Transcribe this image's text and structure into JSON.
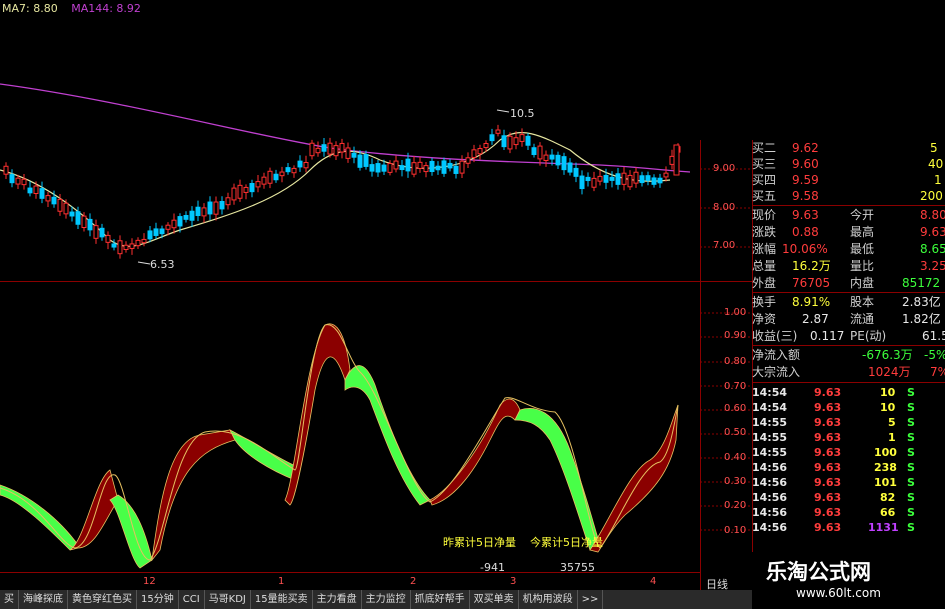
{
  "topbar": {
    "ma7_label": "MA7: 8.80",
    "ma144_label": "MA144: 8.92"
  },
  "colors": {
    "ma7": "#e6e6a0",
    "ma144": "#c040d0",
    "up": "#00c8ff",
    "down": "#ff3030",
    "grid": "#8b0000",
    "green_band": "#48ff48",
    "red_band": "#8b0000"
  },
  "price_axis": [
    "9.00",
    "8.00",
    "7.00"
  ],
  "indicator_axis": [
    "1.00",
    "0.90",
    "0.80",
    "0.70",
    "0.60",
    "0.50",
    "0.40",
    "0.30",
    "0.20",
    "0.10"
  ],
  "annotations": {
    "high": "10.5",
    "low": "6.53",
    "legend_prev": "昨累计5日净量",
    "legend_today": "今累计5日净量",
    "value_prev": "-941",
    "value_today": "35755"
  },
  "x_axis": [
    "12",
    "1",
    "2",
    "3",
    "4"
  ],
  "quote": {
    "bids": [
      {
        "label": "买二",
        "price": "9.62",
        "vol": "5"
      },
      {
        "label": "买三",
        "price": "9.60",
        "vol": "40"
      },
      {
        "label": "买四",
        "price": "9.59",
        "vol": "1"
      },
      {
        "label": "买五",
        "price": "9.58",
        "vol": "200"
      }
    ],
    "rows": [
      {
        "l1": "现价",
        "v1": "9.63",
        "l2": "今开",
        "v2": "8.80"
      },
      {
        "l1": "涨跌",
        "v1": "0.88",
        "l2": "最高",
        "v2": "9.63"
      },
      {
        "l1": "涨幅",
        "v1": "10.06%",
        "l2": "最低",
        "v2": "8.65"
      },
      {
        "l1": "总量",
        "v1": "16.2万",
        "l2": "量比",
        "v2": "3.25"
      },
      {
        "l1": "外盘",
        "v1": "76705",
        "l2": "内盘",
        "v2": "85172"
      },
      {
        "l1": "换手",
        "v1": "8.91%",
        "l2": "股本",
        "v2": "2.83亿"
      },
      {
        "l1": "净资",
        "v1": "2.87",
        "l2": "流通",
        "v2": "1.82亿"
      },
      {
        "l1": "收益(三)",
        "v1": "0.117",
        "l2": "PE(动)",
        "v2": "61.5"
      }
    ],
    "netflow": {
      "label": "净流入额",
      "value": "-676.3万",
      "pct": "-5%"
    },
    "block": {
      "label": "大宗流入",
      "value": "1024万",
      "pct": "7%"
    }
  },
  "ticks": [
    {
      "t": "14:54",
      "p": "9.63",
      "v": "10",
      "s": "S"
    },
    {
      "t": "14:54",
      "p": "9.63",
      "v": "10",
      "s": "S"
    },
    {
      "t": "14:55",
      "p": "9.63",
      "v": "5",
      "s": "S"
    },
    {
      "t": "14:55",
      "p": "9.63",
      "v": "1",
      "s": "S"
    },
    {
      "t": "14:55",
      "p": "9.63",
      "v": "100",
      "s": "S"
    },
    {
      "t": "14:56",
      "p": "9.63",
      "v": "238",
      "s": "S"
    },
    {
      "t": "14:56",
      "p": "9.63",
      "v": "101",
      "s": "S"
    },
    {
      "t": "14:56",
      "p": "9.63",
      "v": "82",
      "s": "S"
    },
    {
      "t": "14:56",
      "p": "9.63",
      "v": "66",
      "s": "S"
    },
    {
      "t": "14:56",
      "p": "9.63",
      "v": "1131",
      "s": "S"
    }
  ],
  "tabs": [
    "买",
    "海峰探底",
    "黄色穿红色买",
    "15分钟",
    "CCI",
    "马哥KDJ",
    "15量能买卖",
    "主力看盘",
    "主力监控",
    "抓底好帮手",
    "双买单卖",
    "机构用波段"
  ],
  "tab_more": ">>",
  "period_label": "日线",
  "brand": {
    "name": "乐淘公式网",
    "url": "www.60lt.com"
  }
}
